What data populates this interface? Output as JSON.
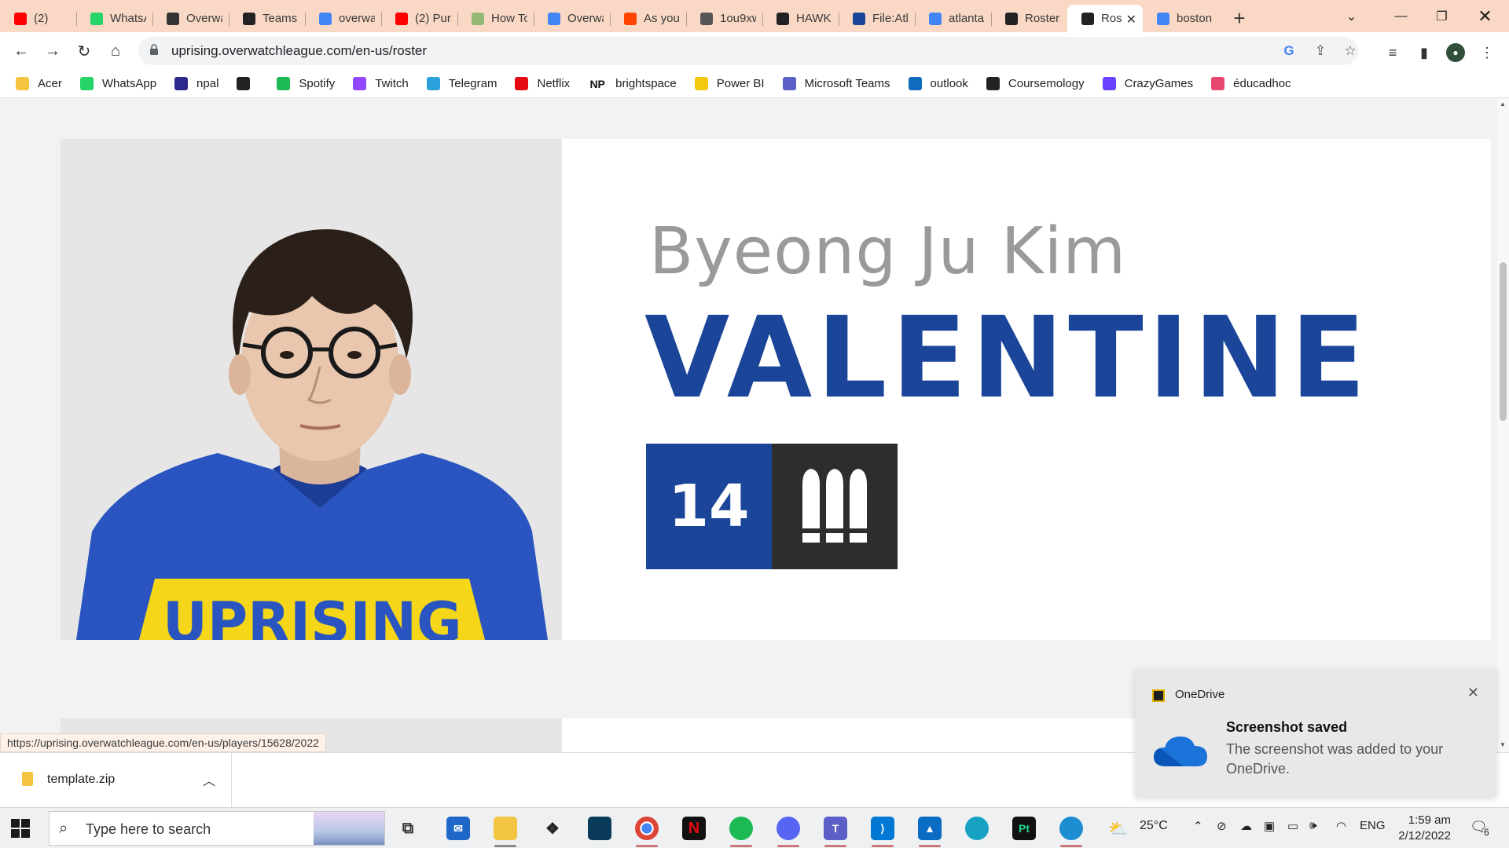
{
  "browser": {
    "tabs": [
      {
        "label": "(2)",
        "icon": "youtube-icon",
        "color": "#ff0000"
      },
      {
        "label": "WhatsA",
        "icon": "whatsapp-icon",
        "color": "#25d366"
      },
      {
        "label": "Overwa",
        "icon": "overwatch-icon",
        "color": "#333333"
      },
      {
        "label": "Teams",
        "icon": "team-logo-icon",
        "color": "#222222"
      },
      {
        "label": "overwa",
        "icon": "google-icon",
        "color": "#4285f4"
      },
      {
        "label": "(2) Pure",
        "icon": "youtube-icon",
        "color": "#ff0000"
      },
      {
        "label": "How To",
        "icon": "wikihow-icon",
        "color": "#93b874"
      },
      {
        "label": "Overwa",
        "icon": "google-icon",
        "color": "#4285f4"
      },
      {
        "label": "As you",
        "icon": "reddit-icon",
        "color": "#ff4500"
      },
      {
        "label": "1ou9xw",
        "icon": "globe-icon",
        "color": "#555555"
      },
      {
        "label": "HAWK",
        "icon": "team-logo-icon",
        "color": "#222222"
      },
      {
        "label": "File:Atl",
        "icon": "wiki-icon",
        "color": "#1a4599"
      },
      {
        "label": "atlanta",
        "icon": "google-icon",
        "color": "#4285f4"
      },
      {
        "label": "Roster",
        "icon": "team-logo-icon",
        "color": "#222222"
      },
      {
        "label": "Ros",
        "icon": "team-logo-icon",
        "color": "#222222",
        "active": true
      },
      {
        "label": "boston",
        "icon": "google-icon",
        "color": "#4285f4"
      }
    ],
    "url": "uprising.overwatchleague.com/en-us/roster",
    "bookmarks": [
      {
        "label": "Acer",
        "color": "#f5c542"
      },
      {
        "label": "WhatsApp",
        "color": "#25d366"
      },
      {
        "label": "npal",
        "color": "#2b2a8c"
      },
      {
        "label": "",
        "color": "#222222"
      },
      {
        "label": "Spotify",
        "color": "#1db954"
      },
      {
        "label": "Twitch",
        "color": "#9146ff"
      },
      {
        "label": "Telegram",
        "color": "#2aa1da"
      },
      {
        "label": "Netflix",
        "color": "#e50914"
      },
      {
        "label": "brightspace",
        "color": "#111111",
        "prefix": "NP"
      },
      {
        "label": "Power BI",
        "color": "#f2c811"
      },
      {
        "label": "Microsoft Teams",
        "color": "#5b5fc7"
      },
      {
        "label": "outlook",
        "color": "#0f6cbd"
      },
      {
        "label": "Coursemology",
        "color": "#222222"
      },
      {
        "label": "CrazyGames",
        "color": "#6842ff"
      },
      {
        "label": "éducadhoc",
        "color": "#e8476f"
      }
    ]
  },
  "player": {
    "real_name": "Byeong Ju Kim",
    "handle": "VALENTINE",
    "number": "14",
    "role": "damage-role-icon",
    "team_color": "#1a4599",
    "shirt_text": "UPRISING"
  },
  "status_url": "https://uprising.overwatchleague.com/en-us/players/15628/2022",
  "download": {
    "filename": "template.zip"
  },
  "toast": {
    "app": "OneDrive",
    "title": "Screenshot saved",
    "body": "The screenshot was added to your OneDrive."
  },
  "taskbar": {
    "search_placeholder": "Type here to search",
    "temperature": "25°C",
    "language": "ENG",
    "time": "1:59 am",
    "date": "2/12/2022",
    "notifications": "6"
  }
}
